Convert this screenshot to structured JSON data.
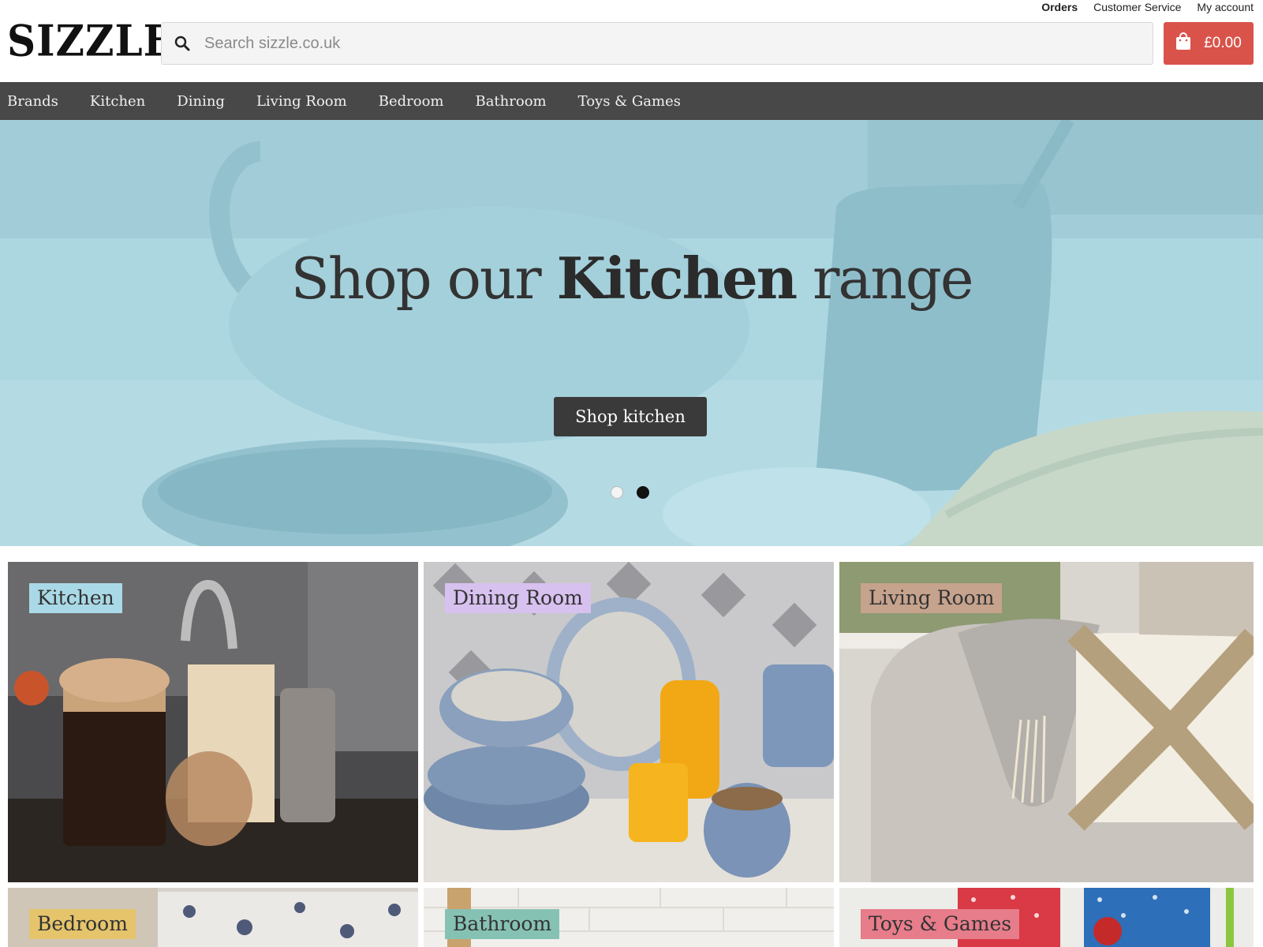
{
  "utility_links": {
    "orders": "Orders",
    "customer_service": "Customer Service",
    "my_account": "My account"
  },
  "header": {
    "logo": "SIZZLE",
    "search_placeholder": "Search sizzle.co.uk",
    "cart_total": "£0.00"
  },
  "nav": {
    "items": [
      {
        "label": "Brands"
      },
      {
        "label": "Kitchen"
      },
      {
        "label": "Dining"
      },
      {
        "label": "Living Room"
      },
      {
        "label": "Bedroom"
      },
      {
        "label": "Bathroom"
      },
      {
        "label": "Toys & Games"
      }
    ]
  },
  "hero": {
    "title_prefix": "Shop our ",
    "title_highlight": "Kitchen",
    "title_suffix": " range",
    "button_label": "Shop kitchen",
    "slides_count": 2,
    "active_slide": 2
  },
  "categories": [
    {
      "label": "Kitchen",
      "label_color": "#a9d9e6"
    },
    {
      "label": "Dining Room",
      "label_color": "#d7c1ef"
    },
    {
      "label": "Living Room",
      "label_color": "#c6a38d"
    },
    {
      "label": "Bedroom",
      "label_color": "#e5c46c"
    },
    {
      "label": "Bathroom",
      "label_color": "#86c2b3"
    },
    {
      "label": "Toys & Games",
      "label_color": "#e77c8a"
    }
  ],
  "colors": {
    "nav_bg": "#484848",
    "cart_bg": "#d9534a",
    "hero_bg": "#a9d4df",
    "hero_button_bg": "#3a3a3a"
  },
  "icons": {
    "search": "search-icon",
    "cart": "shopping-bag-icon"
  }
}
